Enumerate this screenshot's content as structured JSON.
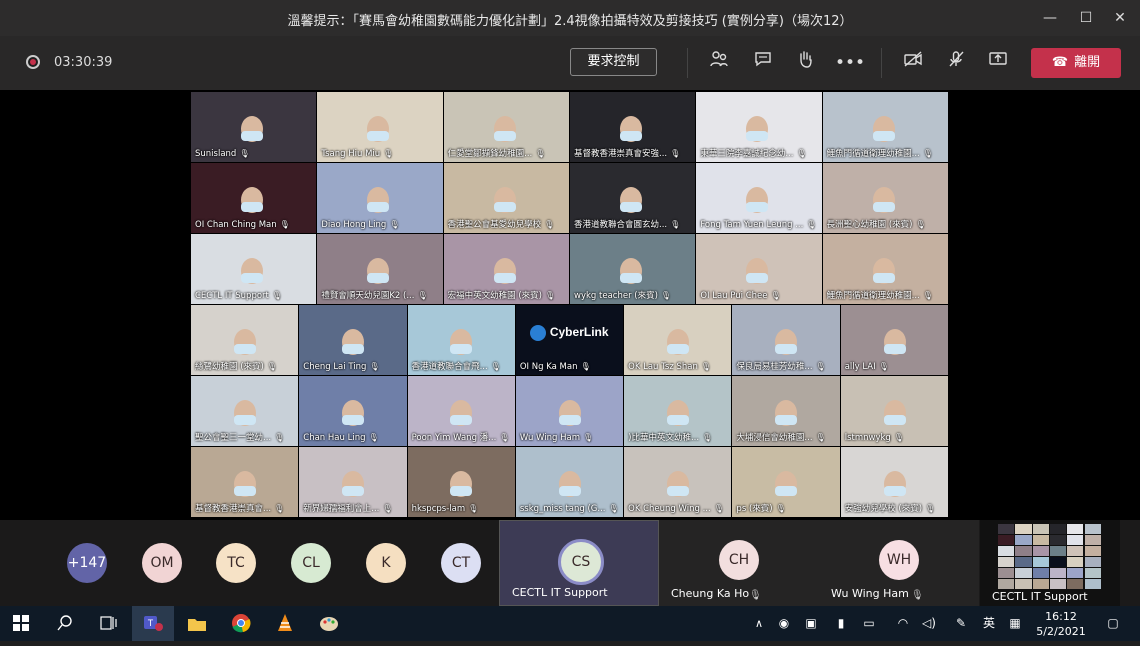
{
  "window": {
    "title": "溫馨提示：「賽馬會幼稚園數碼能力優化計劃」2.4視像拍攝特效及剪接技巧 (實例分享)（場次12）",
    "min": "—",
    "max": "☐",
    "close": "✕"
  },
  "toolbar": {
    "timer": "03:30:39",
    "request_control": "要求控制",
    "leave": "離開"
  },
  "gallery": {
    "tiles": [
      {
        "label": "Sunisland",
        "bg": "#3b3640"
      },
      {
        "label": "Tsang Hiu Miu",
        "bg": "#dcd3c2"
      },
      {
        "label": "仁愛堂鄒擷鋒幼稚園...",
        "bg": "#c9c4b6"
      },
      {
        "label": "基督教香港崇真會安強...",
        "bg": "#25252a"
      },
      {
        "label": "東華三院李嘉誠紀念幼...",
        "bg": "#e6e6ea"
      },
      {
        "label": "鯉魚門循道衛理幼稚園...",
        "bg": "#b8c2cc"
      },
      {
        "label": "OI Chan Ching Man",
        "bg": "#3a1c24"
      },
      {
        "label": "Diao Hong Ling",
        "bg": "#9aa8c8"
      },
      {
        "label": "香港聖公會基愛幼兒學校",
        "bg": "#c8b9a2"
      },
      {
        "label": "香港道教聯合會圓玄幼...",
        "bg": "#2a2a2f"
      },
      {
        "label": "Fong Tam Yuen Leung ...",
        "bg": "#e0e2ea"
      },
      {
        "label": "長洲聖心幼稚園 (來賓)",
        "bg": "#bfb0a8"
      },
      {
        "label": "CECTL IT Support",
        "bg": "#d9dde2"
      },
      {
        "label": "禮賢會順天幼兒園K2 (...",
        "bg": "#8f7f88"
      },
      {
        "label": "宏福中英文幼稚園 (來賓)",
        "bg": "#a995a6"
      },
      {
        "label": "wykg teacher (來賓)",
        "bg": "#6c7f88"
      },
      {
        "label": "OI Lau Pui Chee",
        "bg": "#cfc2b8"
      },
      {
        "label": "鯉魚門循道衛理幼稚園...",
        "bg": "#c4b0a0"
      },
      {
        "label": "絲鷺幼稚園 (來賓)",
        "bg": "#d6d2cc"
      },
      {
        "label": "Cheng Lai Ting",
        "bg": "#5a6a88"
      },
      {
        "label": "香港道教聯合會飛...",
        "bg": "#a7c8d8"
      },
      {
        "label": "OI Ng Ka Man",
        "bg": "#0a0f1c"
      },
      {
        "label": "OK Lau Tsz Shan",
        "bg": "#d8d0c0"
      },
      {
        "label": "保良局易桂芳幼稚...",
        "bg": "#a8b0bf"
      },
      {
        "label": "ally LAI",
        "bg": "#9c8f92"
      },
      {
        "label": "聖公會聖三一堂幼...",
        "bg": "#c8d0d8"
      },
      {
        "label": "Chan Hau Ling",
        "bg": "#6f7fa8"
      },
      {
        "label": "Poon Yim Wang 潘...",
        "bg": "#bcb4c8"
      },
      {
        "label": "Wu Wing Ham",
        "bg": "#9ca4c8"
      },
      {
        "label": ")比華中英文幼稚...",
        "bg": "#b4c4c8"
      },
      {
        "label": "大埔浸信會幼稚園...",
        "bg": "#b0a8a0"
      },
      {
        "label": "lstmnwykg",
        "bg": "#c8c0b4"
      },
      {
        "label": "基督教香港崇真會...",
        "bg": "#b9a894"
      },
      {
        "label": "新界婦孺福利會上...",
        "bg": "#c8c0c4"
      },
      {
        "label": "hkspcps-lam",
        "bg": "#7d6c60"
      },
      {
        "label": "sskg_miss tang (G...",
        "bg": "#aebfcc"
      },
      {
        "label": "OK Cheung Wing ...",
        "bg": "#c8c2bc"
      },
      {
        "label": "ps (來賓)",
        "bg": "#c8bca4"
      },
      {
        "label": "安強幼兒學校 (來賓)",
        "bg": "#d8d6d4"
      }
    ],
    "cyberlink": "CyberLink"
  },
  "participants": {
    "overflow": "+147",
    "avatars": [
      {
        "initials": "OM",
        "color": "#f1d4d4"
      },
      {
        "initials": "TC",
        "color": "#f6e2c6"
      },
      {
        "initials": "CL",
        "color": "#d7ead2"
      },
      {
        "initials": "K",
        "color": "#f5dfc1"
      },
      {
        "initials": "CT",
        "color": "#dcdff3"
      }
    ],
    "featured": [
      {
        "initials": "CS",
        "name": "CECTL IT Support",
        "color": "#dde8d6"
      },
      {
        "initials": "CH",
        "name": "Cheung Ka Ho",
        "color": "#f2dede"
      },
      {
        "initials": "WH",
        "name": "Wu Wing Ham",
        "color": "#f7dfe3"
      }
    ],
    "self_view_label": "CECTL IT Support"
  },
  "taskbar": {
    "time": "16:12",
    "date": "5/2/2021",
    "lang": "英"
  }
}
